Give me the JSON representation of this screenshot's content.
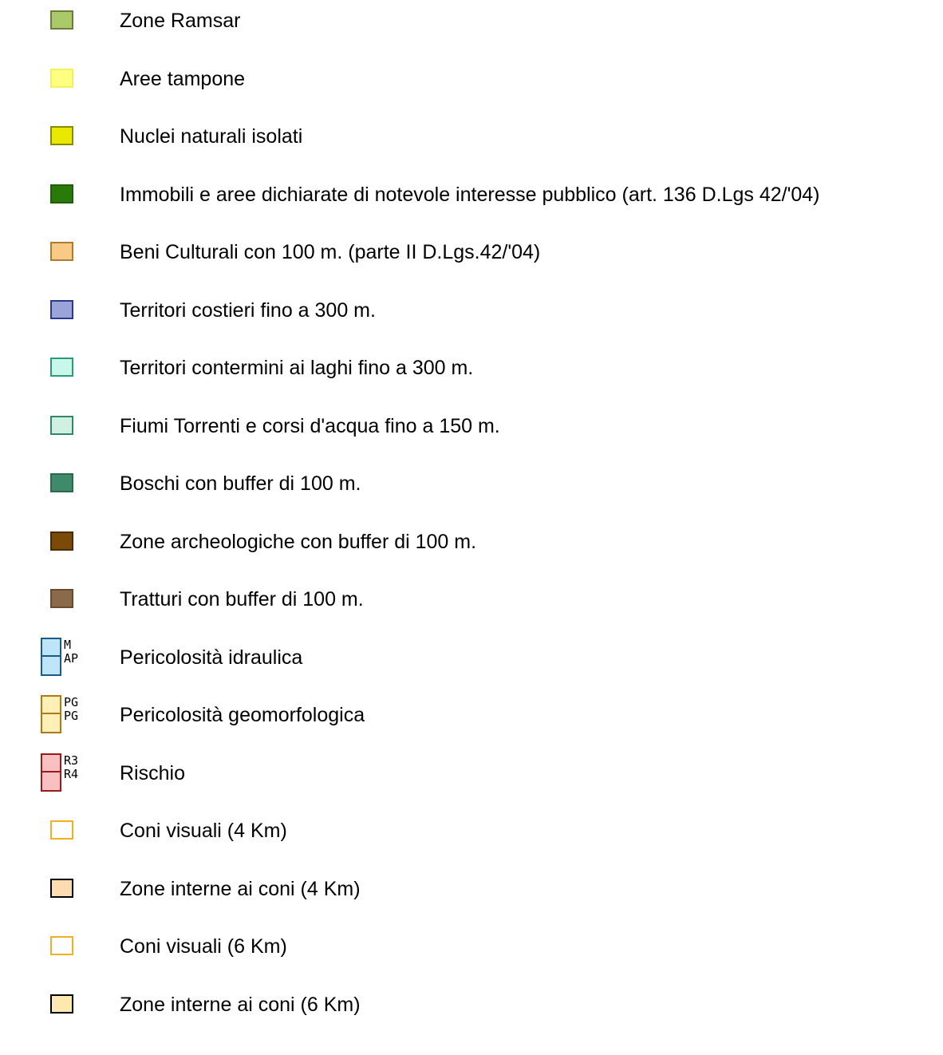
{
  "legend": {
    "items": [
      {
        "label": "Zone Ramsar",
        "icon": "green-square",
        "fill": "#a9c96b",
        "stroke": "#6a7d3a"
      },
      {
        "label": "Aree tampone",
        "icon": "light-yellow-square",
        "fill": "#ffff80",
        "stroke": "#f2f260"
      },
      {
        "label": "Nuclei naturali isolati",
        "icon": "yellow-square",
        "fill": "#e8e800",
        "stroke": "#8a8a00"
      },
      {
        "label": "Immobili e aree dichiarate di notevole interesse pubblico (art. 136 D.Lgs 42/'04)",
        "icon": "dark-green-square",
        "fill": "#2a7a0a",
        "stroke": "#1e5c06"
      },
      {
        "label": "Beni Culturali con 100 m. (parte II  D.Lgs.42/'04)",
        "icon": "orange-square",
        "fill": "#f7ca86",
        "stroke": "#b07a30"
      },
      {
        "label": "Territori costieri fino a 300 m.",
        "icon": "blue-square",
        "fill": "#9aa4d8",
        "stroke": "#2a3a8a"
      },
      {
        "label": "Territori contermini ai laghi fino a 300 m.",
        "icon": "aqua-square",
        "fill": "#c8f8ea",
        "stroke": "#2a9a7a"
      },
      {
        "label": "Fiumi Torrenti e corsi d'acqua fino a 150 m.",
        "icon": "pale-aqua-square",
        "fill": "#d0f0e4",
        "stroke": "#2a8a6a"
      },
      {
        "label": "Boschi con buffer di 100 m.",
        "icon": "teal-square",
        "fill": "#3f8a6a",
        "stroke": "#2a6a4a"
      },
      {
        "label": "Zone archeologiche con buffer di 100 m.",
        "icon": "brown-square",
        "fill": "#7a4a06",
        "stroke": "#4a2a00"
      },
      {
        "label": "Tratturi con buffer di 100 m.",
        "icon": "taupe-square",
        "fill": "#8a6a4a",
        "stroke": "#6a4a2a"
      },
      {
        "label": "Pericolosità idraulica",
        "icon": "hydraulic-hazard-split-icon",
        "split": true,
        "fill": "#bde4f7",
        "stroke": "#1a5a8a",
        "codes": [
          "M",
          "AP"
        ]
      },
      {
        "label": "Pericolosità geomorfologica",
        "icon": "geomorphological-hazard-split-icon",
        "split": true,
        "fill": "#fff0b8",
        "stroke": "#b07a10",
        "codes": [
          "PG",
          "PG"
        ]
      },
      {
        "label": "Rischio",
        "icon": "risk-split-icon",
        "split": true,
        "fill": "#f8c0c0",
        "stroke": "#9a1a1a",
        "codes": [
          "R3",
          "R4"
        ]
      },
      {
        "label": "Coni visuali (4 Km)",
        "icon": "outline-orange-square",
        "fill": "#ffffff",
        "stroke": "#f2b020"
      },
      {
        "label": "Zone interne ai coni (4 Km)",
        "icon": "peach-square",
        "fill": "#ffdcb0",
        "stroke": "#000000"
      },
      {
        "label": "Coni visuali (6 Km)",
        "icon": "outline-orange-square",
        "fill": "#ffffff",
        "stroke": "#f2b020"
      },
      {
        "label": "Zone interne ai coni (6 Km)",
        "icon": "light-peach-square",
        "fill": "#fde8b0",
        "stroke": "#000000"
      }
    ]
  }
}
